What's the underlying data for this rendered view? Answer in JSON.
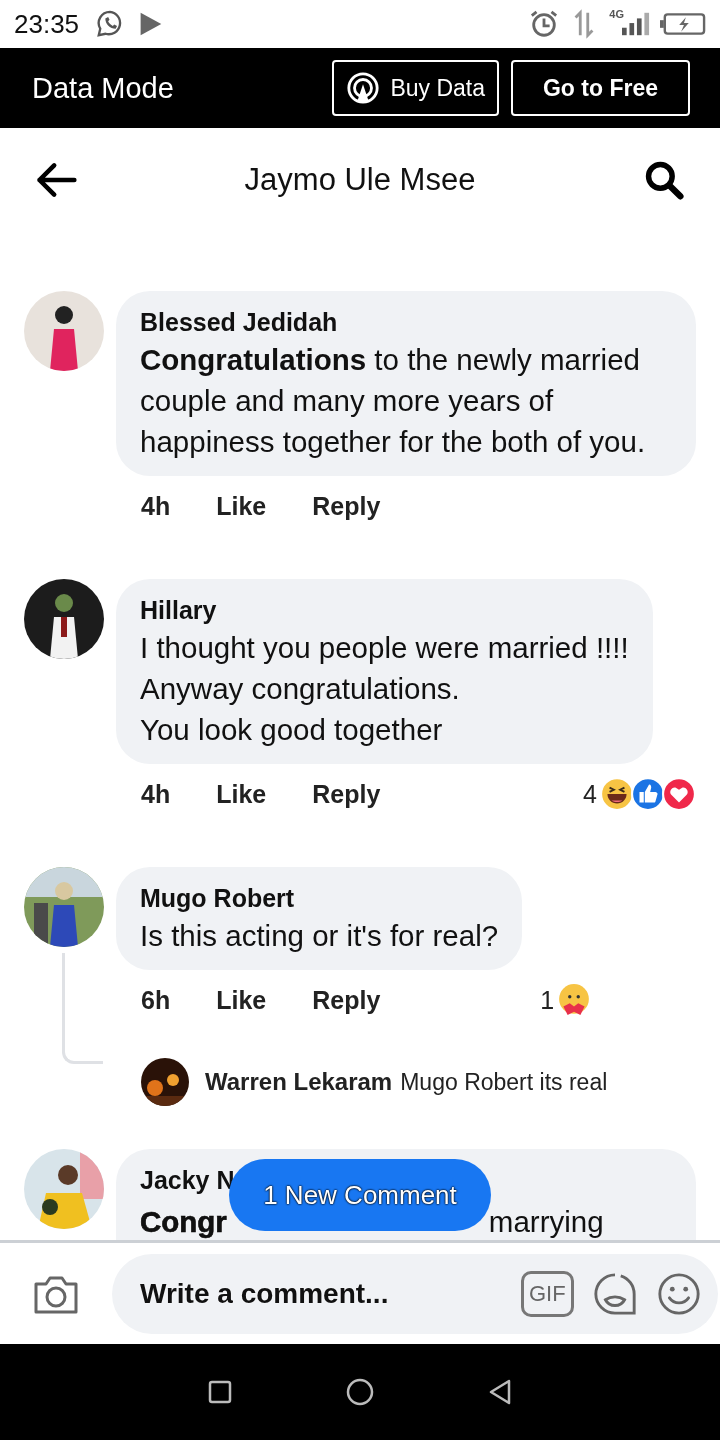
{
  "status_bar": {
    "time": "23:35",
    "network": "4G"
  },
  "data_bar": {
    "title": "Data Mode",
    "buttons": [
      {
        "label": "Buy Data",
        "kind": "buy"
      },
      {
        "label": "Go to Free",
        "kind": "free"
      }
    ]
  },
  "header": {
    "title": "Jaymo Ule Msee"
  },
  "comments": [
    {
      "author": "Blessed Jedidah",
      "text": "**Congratulations** to the newly married couple and many more years of happiness together for the both of you.",
      "time": "4h",
      "like": "Like",
      "reply": "Reply"
    },
    {
      "author": "Hillary",
      "text": "I thought you people were married !!!!\nAnyway congratulations.\nYou look good together",
      "time": "4h",
      "like": "Like",
      "reply": "Reply",
      "reaction_count": "4",
      "reactions": [
        {
          "kind": "haha"
        },
        {
          "kind": "like"
        },
        {
          "kind": "love"
        }
      ]
    },
    {
      "author": "Mugo Robert",
      "text": "Is this acting or it's for real?",
      "time": "6h",
      "like": "Like",
      "reply": "Reply",
      "reaction_count": "1",
      "reactions": [
        {
          "kind": "care"
        }
      ],
      "replies": [
        {
          "author": "Warren Lekaram",
          "text": "Mugo Robert its real"
        }
      ]
    }
  ],
  "partial_comment": {
    "author": "Jacky N",
    "text_start": "Congr",
    "text_end": "marrying"
  },
  "new_comment_pill": "1 New Comment",
  "composer": {
    "placeholder": "Write a comment...",
    "gif_label": "GIF"
  }
}
